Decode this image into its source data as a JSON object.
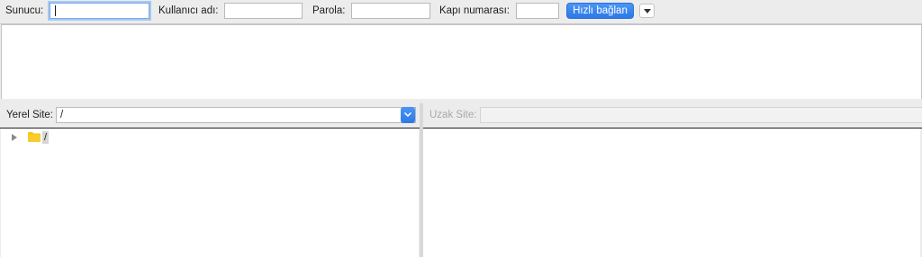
{
  "quickconnect": {
    "host_label": "Sunucu:",
    "host_value": "",
    "user_label": "Kullanıcı adı:",
    "user_value": "",
    "password_label": "Parola:",
    "password_value": "",
    "port_label": "Kapı numarası:",
    "port_value": "",
    "connect_label": "Hızlı bağlan"
  },
  "local": {
    "site_label": "Yerel Site:",
    "path_value": "/",
    "tree": [
      {
        "label": "/",
        "icon": "folder-icon",
        "expanded": false
      }
    ]
  },
  "remote": {
    "site_label": "Uzak Site:",
    "path_value": ""
  },
  "colors": {
    "accent": "#2c79e8",
    "focus_ring": "#a9c8f3",
    "folder": "#f5c518"
  }
}
